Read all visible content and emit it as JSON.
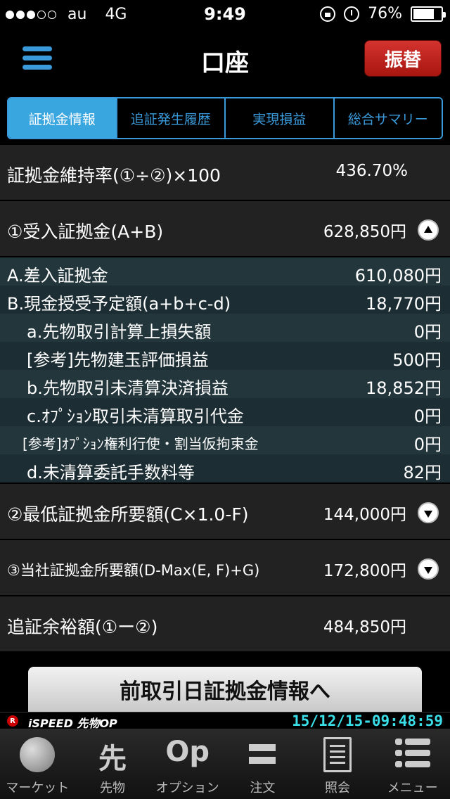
{
  "status": {
    "carrier": "au",
    "network": "4G",
    "time": "9:49",
    "battery": "76%",
    "battery_level": 0.76
  },
  "nav": {
    "title": "口座",
    "transfer_label": "振替"
  },
  "tabs": [
    {
      "label": "証拠金情報",
      "active": true
    },
    {
      "label": "追証発生履歴",
      "active": false
    },
    {
      "label": "実現損益",
      "active": false
    },
    {
      "label": "総合サマリー",
      "active": false
    }
  ],
  "summary": {
    "ratio_label": "証拠金維持率(①÷②)×100",
    "ratio_value": "436.70%",
    "received_label": "①受入証拠金(A+B)",
    "received_value": "628,850円",
    "details": [
      {
        "label": "A.差入証拠金",
        "value": "610,080円"
      },
      {
        "label": "B.現金授受予定額(a+b+c-d)",
        "value": "18,770円"
      },
      {
        "label": "a.先物取引計算上損失額",
        "value": "0円"
      },
      {
        "label": "[参考]先物建玉評価損益",
        "value": "500円"
      },
      {
        "label": "b.先物取引未清算決済損益",
        "value": "18,852円"
      },
      {
        "label": "c.ｵﾌﾟｼｮﾝ取引未清算取引代金",
        "value": "0円"
      },
      {
        "label": "[参考]ｵﾌﾟｼｮﾝ権利行使・割当仮拘束金",
        "value": "0円"
      },
      {
        "label": "d.未清算委託手数料等",
        "value": "82円"
      }
    ],
    "min_label": "②最低証拠金所要額(C×1.0-F)",
    "min_value": "144,000円",
    "company_label": "③当社証拠金所要額(D-Max(E, F)+G)",
    "company_value": "172,800円",
    "margin_label": "追証余裕額(①ー②)",
    "margin_value": "484,850円"
  },
  "prev_day_button": "前取引日証拠金情報へ",
  "appbar": {
    "badge": "R",
    "logo": "iSPEED 先物OP",
    "timestamp": "15/12/15-09:48:59"
  },
  "tabbar": [
    {
      "label": "マーケット",
      "icon": "globe-icon"
    },
    {
      "label": "先物",
      "icon": "futures-icon",
      "glyph": "先"
    },
    {
      "label": "オプション",
      "icon": "option-icon",
      "glyph": "Op"
    },
    {
      "label": "注文",
      "icon": "order-arrows-icon"
    },
    {
      "label": "照会",
      "icon": "document-icon"
    },
    {
      "label": "メニュー",
      "icon": "menu-list-icon"
    }
  ]
}
